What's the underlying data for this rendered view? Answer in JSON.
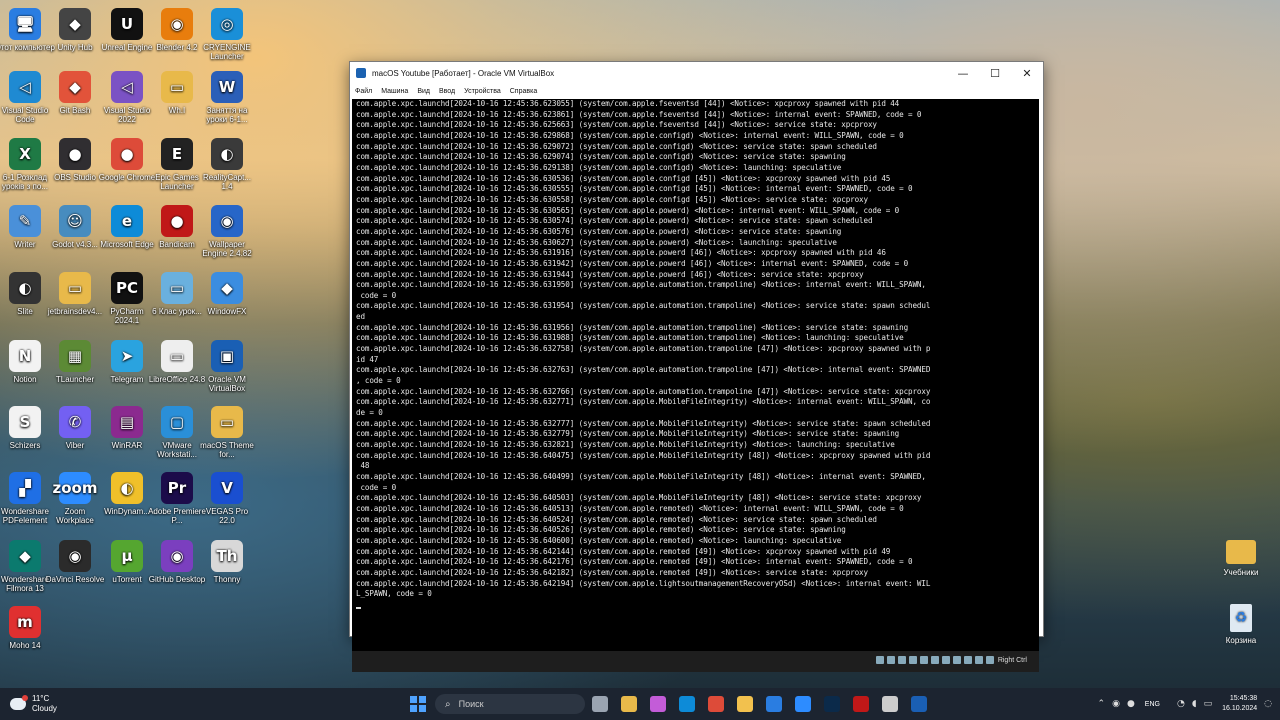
{
  "desktop": {
    "icons": [
      {
        "label": "Этот компьютер",
        "glyph": "🖥",
        "color": "#2a7de1"
      },
      {
        "label": "Unity Hub",
        "glyph": "◆",
        "color": "#444"
      },
      {
        "label": "Unreal Engine",
        "glyph": "U",
        "color": "#111"
      },
      {
        "label": "Blender 4.2",
        "glyph": "◉",
        "color": "#e87d0d"
      },
      {
        "label": "CRYENGINE Launcher",
        "glyph": "◎",
        "color": "#1a8fd8"
      },
      {
        "label": "Visual Studio Code",
        "glyph": "◁",
        "color": "#1f8ad2"
      },
      {
        "label": "Git Bash",
        "glyph": "◆",
        "color": "#e2533a"
      },
      {
        "label": "Visual Studio 2022",
        "glyph": "◁",
        "color": "#7b52c4"
      },
      {
        "label": "Wh.I",
        "glyph": "▭",
        "color": "#e8b94a"
      },
      {
        "label": "Заняття на уроки 6-1...",
        "glyph": "W",
        "color": "#2b5fb8"
      },
      {
        "label": "6-1 Розклад уроків з по...",
        "glyph": "X",
        "color": "#1f7a45"
      },
      {
        "label": "OBS Studio",
        "glyph": "●",
        "color": "#302e31"
      },
      {
        "label": "Google Chrome",
        "glyph": "●",
        "color": "#dd4b39"
      },
      {
        "label": "Epic Games Launcher",
        "glyph": "E",
        "color": "#222"
      },
      {
        "label": "RealityCapt... 1.4",
        "glyph": "◐",
        "color": "#3a3a3a"
      },
      {
        "label": "Writer",
        "glyph": "✎",
        "color": "#4a90d9"
      },
      {
        "label": "Godot v4.3...",
        "glyph": "☺",
        "color": "#478cbf"
      },
      {
        "label": "Microsoft Edge",
        "glyph": "e",
        "color": "#0d8bd8"
      },
      {
        "label": "Bandicam",
        "glyph": "●",
        "color": "#c01818"
      },
      {
        "label": "Wallpaper Engine 2.4.82",
        "glyph": "◉",
        "color": "#2766c8"
      },
      {
        "label": "Slite",
        "glyph": "◐",
        "color": "#333"
      },
      {
        "label": "jetbrainsdev4...",
        "glyph": "▭",
        "color": "#e8b94a"
      },
      {
        "label": "PyCharm 2024.1",
        "glyph": "PC",
        "color": "#111"
      },
      {
        "label": "6 Клас урок...",
        "glyph": "▭",
        "color": "#6ab0de"
      },
      {
        "label": "WindowFX",
        "glyph": "◆",
        "color": "#3b8de0"
      },
      {
        "label": "Notion",
        "glyph": "N",
        "color": "#f2f2f2"
      },
      {
        "label": "TLauncher",
        "glyph": "▦",
        "color": "#5c8a35"
      },
      {
        "label": "Telegram",
        "glyph": "➤",
        "color": "#2aa3df"
      },
      {
        "label": "LibreOffice 24.8",
        "glyph": "▭",
        "color": "#eeeeee"
      },
      {
        "label": "Oracle VM VirtualBox",
        "glyph": "▣",
        "color": "#1a5fb4"
      },
      {
        "label": "Schizers",
        "glyph": "S",
        "color": "#f2f2f2"
      },
      {
        "label": "Viber",
        "glyph": "✆",
        "color": "#7360f2"
      },
      {
        "label": "WinRAR",
        "glyph": "▤",
        "color": "#8b2a8f"
      },
      {
        "label": "VMware Workstati...",
        "glyph": "▢",
        "color": "#2a8fd8"
      },
      {
        "label": "macOS Theme for...",
        "glyph": "▭",
        "color": "#e8b94a"
      },
      {
        "label": "Wondershare PDFelement",
        "glyph": "▞",
        "color": "#1f6fe5"
      },
      {
        "label": "Zoom Workplace",
        "glyph": "zoom",
        "color": "#2d8cff"
      },
      {
        "label": "WinDynam...",
        "glyph": "◐",
        "color": "#f0c02a"
      },
      {
        "label": "Adobe Premiere P...",
        "glyph": "Pr",
        "color": "#1c0c4a"
      },
      {
        "label": "VEGAS Pro 22.0",
        "glyph": "V",
        "color": "#1a4fd0"
      },
      {
        "label": "Wondershare Filmora 13",
        "glyph": "◆",
        "color": "#0b7a6e"
      },
      {
        "label": "DaVinci Resolve",
        "glyph": "◉",
        "color": "#2b2b2b"
      },
      {
        "label": "uTorrent",
        "glyph": "μ",
        "color": "#55a630"
      },
      {
        "label": "GitHub Desktop",
        "glyph": "◉",
        "color": "#7b3fbf"
      },
      {
        "label": "Thonny",
        "glyph": "Th",
        "color": "#d8d8d8"
      },
      {
        "label": "Moho 14",
        "glyph": "m",
        "color": "#e03030"
      }
    ],
    "right_icons": [
      {
        "label": "Учебники",
        "glyph": "▭",
        "color": "#e8b94a"
      },
      {
        "label": "Корзина",
        "glyph": "♻",
        "color": "#dfe9f2"
      }
    ]
  },
  "window": {
    "title": "macOS Youtube [Работает] - Oracle VM VirtualBox",
    "minimize": "—",
    "maximize": "☐",
    "close": "✕",
    "menu": [
      "Файл",
      "Машина",
      "Вид",
      "Ввод",
      "Устройства",
      "Справка"
    ],
    "host_key": "Right Ctrl"
  },
  "terminal": {
    "lines": [
      "com.apple.xpc.launchd[2024-10-16 12:45:36.623055] (system/com.apple.fseventsd [44]) <Notice>: xpcproxy spawned with pid 44",
      "com.apple.xpc.launchd[2024-10-16 12:45:36.623861] (system/com.apple.fseventsd [44]) <Notice>: internal event: SPAWNED, code = 0",
      "com.apple.xpc.launchd[2024-10-16 12:45:36.625663] (system/com.apple.fseventsd [44]) <Notice>: service state: xpcproxy",
      "com.apple.xpc.launchd[2024-10-16 12:45:36.629868] (system/com.apple.configd) <Notice>: internal event: WILL_SPAWN, code = 0",
      "com.apple.xpc.launchd[2024-10-16 12:45:36.629072] (system/com.apple.configd) <Notice>: service state: spawn scheduled",
      "com.apple.xpc.launchd[2024-10-16 12:45:36.629074] (system/com.apple.configd) <Notice>: service state: spawning",
      "com.apple.xpc.launchd[2024-10-16 12:45:36.629138] (system/com.apple.configd) <Notice>: launching: speculative",
      "com.apple.xpc.launchd[2024-10-16 12:45:36.630536] (system/com.apple.configd [45]) <Notice>: xpcproxy spawned with pid 45",
      "com.apple.xpc.launchd[2024-10-16 12:45:36.630555] (system/com.apple.configd [45]) <Notice>: internal event: SPAWNED, code = 0",
      "com.apple.xpc.launchd[2024-10-16 12:45:36.630558] (system/com.apple.configd [45]) <Notice>: service state: xpcproxy",
      "com.apple.xpc.launchd[2024-10-16 12:45:36.630565] (system/com.apple.powerd) <Notice>: internal event: WILL_SPAWN, code = 0",
      "com.apple.xpc.launchd[2024-10-16 12:45:36.630574] (system/com.apple.powerd) <Notice>: service state: spawn scheduled",
      "com.apple.xpc.launchd[2024-10-16 12:45:36.630576] (system/com.apple.powerd) <Notice>: service state: spawning",
      "com.apple.xpc.launchd[2024-10-16 12:45:36.630627] (system/com.apple.powerd) <Notice>: launching: speculative",
      "com.apple.xpc.launchd[2024-10-16 12:45:36.631916] (system/com.apple.powerd [46]) <Notice>: xpcproxy spawned with pid 46",
      "com.apple.xpc.launchd[2024-10-16 12:45:36.631942] (system/com.apple.powerd [46]) <Notice>: internal event: SPAWNED, code = 0",
      "com.apple.xpc.launchd[2024-10-16 12:45:36.631944] (system/com.apple.powerd [46]) <Notice>: service state: xpcproxy",
      "com.apple.xpc.launchd[2024-10-16 12:45:36.631950] (system/com.apple.automation.trampoline) <Notice>: internal event: WILL_SPAWN,",
      " code = 0",
      "com.apple.xpc.launchd[2024-10-16 12:45:36.631954] (system/com.apple.automation.trampoline) <Notice>: service state: spawn schedul",
      "ed",
      "com.apple.xpc.launchd[2024-10-16 12:45:36.631956] (system/com.apple.automation.trampoline) <Notice>: service state: spawning",
      "com.apple.xpc.launchd[2024-10-16 12:45:36.631988] (system/com.apple.automation.trampoline) <Notice>: launching: speculative",
      "com.apple.xpc.launchd[2024-10-16 12:45:36.632758] (system/com.apple.automation.trampoline [47]) <Notice>: xpcproxy spawned with p",
      "id 47",
      "com.apple.xpc.launchd[2024-10-16 12:45:36.632763] (system/com.apple.automation.trampoline [47]) <Notice>: internal event: SPAWNED",
      ", code = 0",
      "com.apple.xpc.launchd[2024-10-16 12:45:36.632766] (system/com.apple.automation.trampoline [47]) <Notice>: service state: xpcproxy",
      "com.apple.xpc.launchd[2024-10-16 12:45:36.632771] (system/com.apple.MobileFileIntegrity) <Notice>: internal event: WILL_SPAWN, co",
      "de = 0",
      "com.apple.xpc.launchd[2024-10-16 12:45:36.632777] (system/com.apple.MobileFileIntegrity) <Notice>: service state: spawn scheduled",
      "com.apple.xpc.launchd[2024-10-16 12:45:36.632779] (system/com.apple.MobileFileIntegrity) <Notice>: service state: spawning",
      "com.apple.xpc.launchd[2024-10-16 12:45:36.632821] (system/com.apple.MobileFileIntegrity) <Notice>: launching: speculative",
      "com.apple.xpc.launchd[2024-10-16 12:45:36.640475] (system/com.apple.MobileFileIntegrity [48]) <Notice>: xpcproxy spawned with pid",
      " 48",
      "com.apple.xpc.launchd[2024-10-16 12:45:36.640499] (system/com.apple.MobileFileIntegrity [48]) <Notice>: internal event: SPAWNED,",
      " code = 0",
      "com.apple.xpc.launchd[2024-10-16 12:45:36.640503] (system/com.apple.MobileFileIntegrity [48]) <Notice>: service state: xpcproxy",
      "com.apple.xpc.launchd[2024-10-16 12:45:36.640513] (system/com.apple.remoted) <Notice>: internal event: WILL_SPAWN, code = 0",
      "com.apple.xpc.launchd[2024-10-16 12:45:36.640524] (system/com.apple.remoted) <Notice>: service state: spawn scheduled",
      "com.apple.xpc.launchd[2024-10-16 12:45:36.640526] (system/com.apple.remoted) <Notice>: service state: spawning",
      "com.apple.xpc.launchd[2024-10-16 12:45:36.640600] (system/com.apple.remoted) <Notice>: launching: speculative",
      "com.apple.xpc.launchd[2024-10-16 12:45:36.642144] (system/com.apple.remoted [49]) <Notice>: xpcproxy spawned with pid 49",
      "com.apple.xpc.launchd[2024-10-16 12:45:36.642176] (system/com.apple.remoted [49]) <Notice>: internal event: SPAWNED, code = 0",
      "com.apple.xpc.launchd[2024-10-16 12:45:36.642182] (system/com.apple.remoted [49]) <Notice>: service state: xpcproxy",
      "com.apple.xpc.launchd[2024-10-16 12:45:36.642194] (system/com.apple.lightsoutmanagementRecoveryOSd) <Notice>: internal event: WIL",
      "L_SPAWN, code = 0"
    ]
  },
  "taskbar": {
    "weather_temp": "11°C",
    "weather_desc": "Cloudy",
    "search_placeholder": "Поиск",
    "lang": "ENG",
    "time": "15:45:38",
    "date": "16.10.2024",
    "pinned": [
      {
        "name": "task-view",
        "color": "#9aa4b1"
      },
      {
        "name": "file-explorer",
        "color": "#e8b94a"
      },
      {
        "name": "copilot",
        "color": "#c35cd8"
      },
      {
        "name": "edge",
        "color": "#0d8bd8"
      },
      {
        "name": "chrome",
        "color": "#dd4b39"
      },
      {
        "name": "explorer-folder",
        "color": "#f2c14e"
      },
      {
        "name": "mail",
        "color": "#2a7de1"
      },
      {
        "name": "zoom",
        "color": "#2d8cff"
      },
      {
        "name": "photoshop",
        "color": "#0b2a4a"
      },
      {
        "name": "obs",
        "color": "#c01818"
      },
      {
        "name": "unity",
        "color": "#cccccc"
      },
      {
        "name": "virtualbox",
        "color": "#1a5fb4"
      }
    ]
  }
}
